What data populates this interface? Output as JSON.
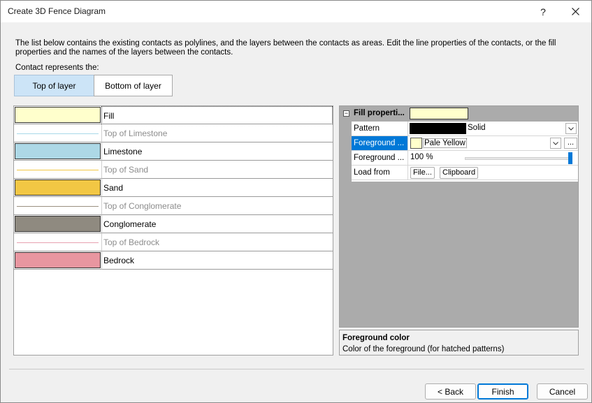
{
  "window": {
    "title": "Create 3D Fence Diagram",
    "help_glyph": "?"
  },
  "description": "The list below contains the existing contacts as polylines, and the layers between the contacts as areas. Edit the line properties of the contacts, or the fill properties and the names of the layers between the contacts.",
  "contact_label": "Contact represents the:",
  "segmented": {
    "top_label": "Top of layer",
    "bottom_label": "Bottom of layer",
    "selected": "Top of layer"
  },
  "layers": [
    {
      "kind": "layer",
      "name": "Fill",
      "color": "#ffffcc",
      "selected": true
    },
    {
      "kind": "contact",
      "name": "Top of Limestone",
      "color": "#a8d8e8"
    },
    {
      "kind": "layer",
      "name": "Limestone",
      "color": "#add8e6"
    },
    {
      "kind": "contact",
      "name": "Top of Sand",
      "color": "#f2c744"
    },
    {
      "kind": "layer",
      "name": "Sand",
      "color": "#f2c744"
    },
    {
      "kind": "contact",
      "name": "Top of Conglomerate",
      "color": "#9a9080"
    },
    {
      "kind": "layer",
      "name": "Conglomerate",
      "color": "#8f8a80"
    },
    {
      "kind": "contact",
      "name": "Top of Bedrock",
      "color": "#e8a0b0"
    },
    {
      "kind": "layer",
      "name": "Bedrock",
      "color": "#e896a0"
    }
  ],
  "properties": {
    "header": "Fill properti...",
    "header_color": "#ffffcc",
    "collapse_glyph": "−",
    "rows": {
      "pattern": {
        "label": "Pattern",
        "value": "Solid",
        "swatch_color": "#000000"
      },
      "fg_color": {
        "label": "Foreground ...",
        "value": "Pale Yellow",
        "swatch_color": "#ffffcc",
        "ellipsis": "..."
      },
      "fg_opacity": {
        "label": "Foreground ...",
        "value": "100 %",
        "level_percent": 100
      },
      "load_from": {
        "label": "Load from",
        "file_button": "File...",
        "clipboard_button": "Clipboard"
      }
    }
  },
  "help": {
    "title": "Foreground color",
    "text": "Color of the foreground (for hatched patterns)"
  },
  "buttons": {
    "back": "< Back",
    "finish": "Finish",
    "cancel": "Cancel"
  }
}
